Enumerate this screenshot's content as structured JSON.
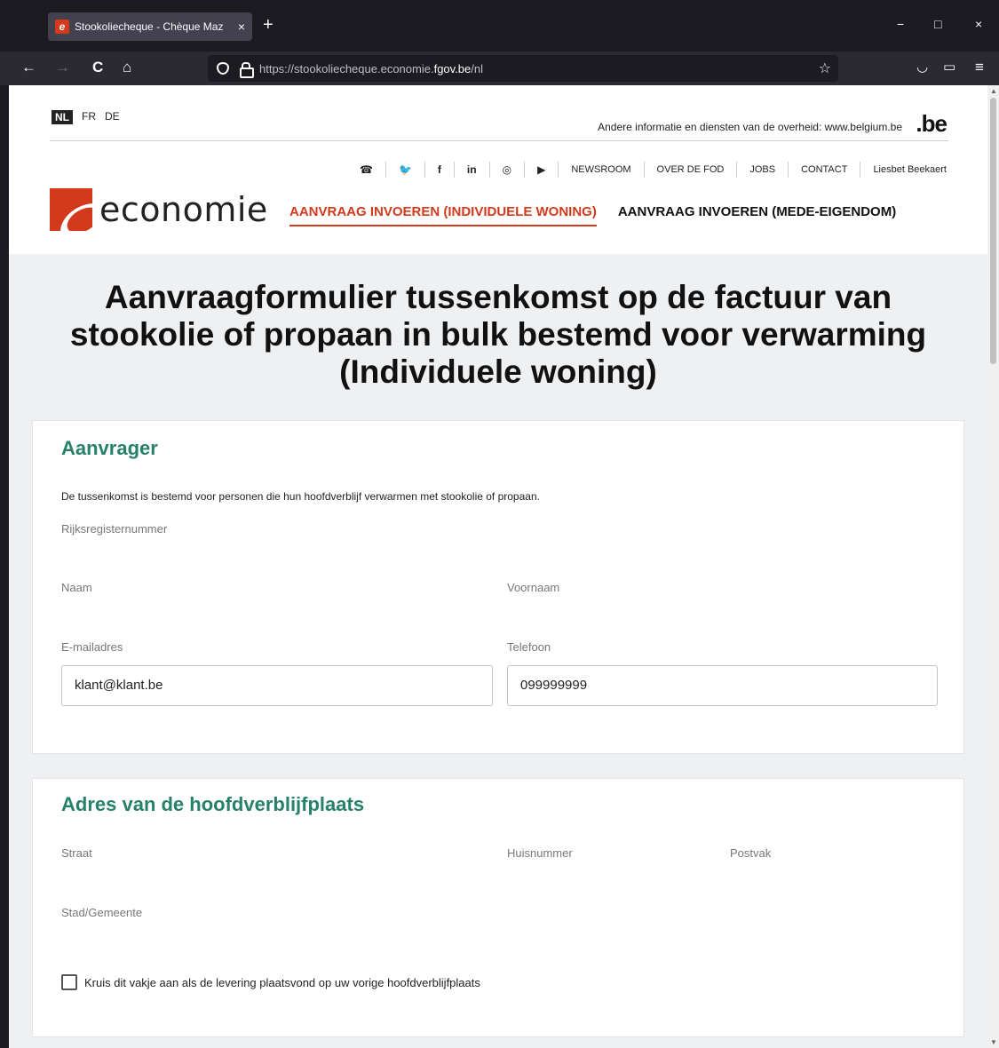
{
  "browser": {
    "tab_title": "Stookoliecheque - Chèque Maz",
    "tab_close": "×",
    "new_tab": "+",
    "window_controls": {
      "minimize": "−",
      "maximize": "□",
      "close": "×"
    },
    "nav": {
      "back": "←",
      "forward": "→",
      "reload": "C",
      "home": "⌂"
    },
    "url_prefix": "https://stookoliecheque.economie.",
    "url_domain": "fgov.be",
    "url_suffix": "/nl",
    "bookmark_icon": "☆",
    "pocket_icon": "◡",
    "reader_icon": "▭",
    "menu_icon": "≡"
  },
  "header": {
    "languages": [
      "NL",
      "FR",
      "DE"
    ],
    "gov_info": "Andere informatie en diensten van de overheid: www.belgium.be",
    "be_logo": ".be",
    "social_icons": [
      "☎",
      "🐦",
      "f",
      "in",
      "◎",
      "▶"
    ],
    "top_links": [
      "NEWSROOM",
      "OVER DE FOD",
      "JOBS",
      "CONTACT",
      "Liesbet Beekaert"
    ],
    "logo_text": "economie",
    "nav": [
      {
        "label": "AANVRAAG INVOEREN (INDIVIDUELE WONING)",
        "active": true
      },
      {
        "label": "AANVRAAG INVOEREN (MEDE-EIGENDOM)",
        "active": false
      }
    ]
  },
  "page_title": "Aanvraagformulier tussenkomst op de factuur van stookolie of propaan in bulk bestemd voor verwarming (Individuele woning)",
  "applicant": {
    "heading": "Aanvrager",
    "intro": "De tussenkomst is bestemd voor personen die hun hoofdverblijf verwarmen met stookolie of propaan.",
    "national_id_label": "Rijksregisternummer",
    "last_name_label": "Naam",
    "first_name_label": "Voornaam",
    "email_label": "E-mailadres",
    "email_value": "klant@klant.be",
    "phone_label": "Telefoon",
    "phone_value": "099999999"
  },
  "address": {
    "heading": "Adres van de hoofdverblijfplaats",
    "street_label": "Straat",
    "house_number_label": "Huisnummer",
    "box_label": "Postvak",
    "city_label": "Stad/Gemeente",
    "checkbox_label": "Kruis dit vakje aan als de levering plaatsvond op uw vorige hoofdverblijfplaats"
  }
}
